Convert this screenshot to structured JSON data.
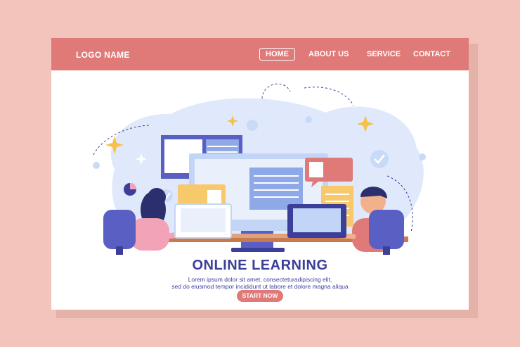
{
  "nav": {
    "logo": "LOGO NAME",
    "items": [
      "HOME",
      "ABOUT US",
      "SERVICE",
      "CONTACT"
    ]
  },
  "hero": {
    "title": "ONLINE LEARNING",
    "body_line1": "Lorem ipsum dolor sit amet, consectetura­dipiscing elit,",
    "body_line2": "sed do eiusmod tempor incididunt ut labore et dolore magna aliqua",
    "cta": "START NOW"
  },
  "colors": {
    "background": "#f3c4bb",
    "nav": "#e07a78",
    "title": "#3b3f99",
    "chair": "#5a5fc4",
    "blob": "#dfe9fb"
  },
  "illustration": {
    "people": [
      "woman-with-laptop",
      "man-with-laptop"
    ],
    "icons": [
      "checkmark-icon",
      "pie-chart-icon",
      "sparkle-icon",
      "chat-bubble-icon",
      "document-icon"
    ]
  }
}
